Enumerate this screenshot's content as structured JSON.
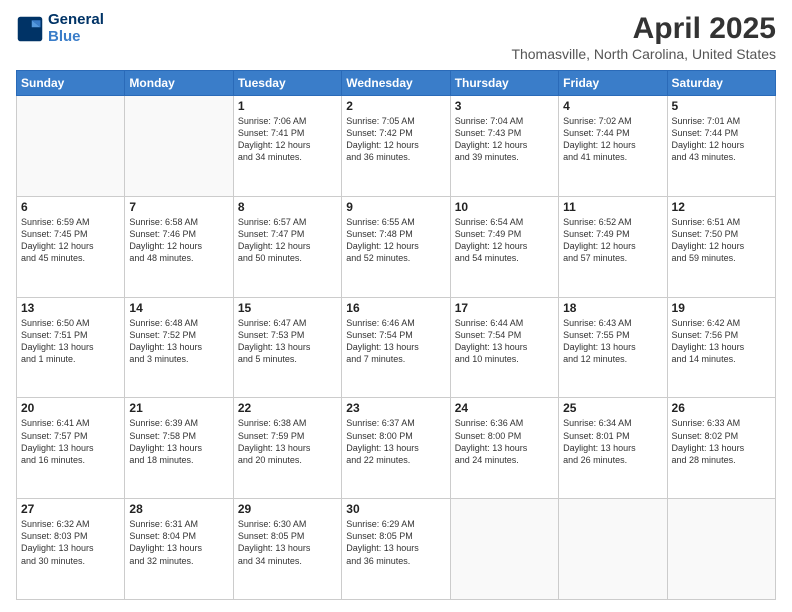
{
  "header": {
    "logo_line1": "General",
    "logo_line2": "Blue",
    "title": "April 2025",
    "subtitle": "Thomasville, North Carolina, United States"
  },
  "calendar": {
    "weekdays": [
      "Sunday",
      "Monday",
      "Tuesday",
      "Wednesday",
      "Thursday",
      "Friday",
      "Saturday"
    ],
    "weeks": [
      [
        {
          "day": "",
          "info": ""
        },
        {
          "day": "",
          "info": ""
        },
        {
          "day": "1",
          "info": "Sunrise: 7:06 AM\nSunset: 7:41 PM\nDaylight: 12 hours\nand 34 minutes."
        },
        {
          "day": "2",
          "info": "Sunrise: 7:05 AM\nSunset: 7:42 PM\nDaylight: 12 hours\nand 36 minutes."
        },
        {
          "day": "3",
          "info": "Sunrise: 7:04 AM\nSunset: 7:43 PM\nDaylight: 12 hours\nand 39 minutes."
        },
        {
          "day": "4",
          "info": "Sunrise: 7:02 AM\nSunset: 7:44 PM\nDaylight: 12 hours\nand 41 minutes."
        },
        {
          "day": "5",
          "info": "Sunrise: 7:01 AM\nSunset: 7:44 PM\nDaylight: 12 hours\nand 43 minutes."
        }
      ],
      [
        {
          "day": "6",
          "info": "Sunrise: 6:59 AM\nSunset: 7:45 PM\nDaylight: 12 hours\nand 45 minutes."
        },
        {
          "day": "7",
          "info": "Sunrise: 6:58 AM\nSunset: 7:46 PM\nDaylight: 12 hours\nand 48 minutes."
        },
        {
          "day": "8",
          "info": "Sunrise: 6:57 AM\nSunset: 7:47 PM\nDaylight: 12 hours\nand 50 minutes."
        },
        {
          "day": "9",
          "info": "Sunrise: 6:55 AM\nSunset: 7:48 PM\nDaylight: 12 hours\nand 52 minutes."
        },
        {
          "day": "10",
          "info": "Sunrise: 6:54 AM\nSunset: 7:49 PM\nDaylight: 12 hours\nand 54 minutes."
        },
        {
          "day": "11",
          "info": "Sunrise: 6:52 AM\nSunset: 7:49 PM\nDaylight: 12 hours\nand 57 minutes."
        },
        {
          "day": "12",
          "info": "Sunrise: 6:51 AM\nSunset: 7:50 PM\nDaylight: 12 hours\nand 59 minutes."
        }
      ],
      [
        {
          "day": "13",
          "info": "Sunrise: 6:50 AM\nSunset: 7:51 PM\nDaylight: 13 hours\nand 1 minute."
        },
        {
          "day": "14",
          "info": "Sunrise: 6:48 AM\nSunset: 7:52 PM\nDaylight: 13 hours\nand 3 minutes."
        },
        {
          "day": "15",
          "info": "Sunrise: 6:47 AM\nSunset: 7:53 PM\nDaylight: 13 hours\nand 5 minutes."
        },
        {
          "day": "16",
          "info": "Sunrise: 6:46 AM\nSunset: 7:54 PM\nDaylight: 13 hours\nand 7 minutes."
        },
        {
          "day": "17",
          "info": "Sunrise: 6:44 AM\nSunset: 7:54 PM\nDaylight: 13 hours\nand 10 minutes."
        },
        {
          "day": "18",
          "info": "Sunrise: 6:43 AM\nSunset: 7:55 PM\nDaylight: 13 hours\nand 12 minutes."
        },
        {
          "day": "19",
          "info": "Sunrise: 6:42 AM\nSunset: 7:56 PM\nDaylight: 13 hours\nand 14 minutes."
        }
      ],
      [
        {
          "day": "20",
          "info": "Sunrise: 6:41 AM\nSunset: 7:57 PM\nDaylight: 13 hours\nand 16 minutes."
        },
        {
          "day": "21",
          "info": "Sunrise: 6:39 AM\nSunset: 7:58 PM\nDaylight: 13 hours\nand 18 minutes."
        },
        {
          "day": "22",
          "info": "Sunrise: 6:38 AM\nSunset: 7:59 PM\nDaylight: 13 hours\nand 20 minutes."
        },
        {
          "day": "23",
          "info": "Sunrise: 6:37 AM\nSunset: 8:00 PM\nDaylight: 13 hours\nand 22 minutes."
        },
        {
          "day": "24",
          "info": "Sunrise: 6:36 AM\nSunset: 8:00 PM\nDaylight: 13 hours\nand 24 minutes."
        },
        {
          "day": "25",
          "info": "Sunrise: 6:34 AM\nSunset: 8:01 PM\nDaylight: 13 hours\nand 26 minutes."
        },
        {
          "day": "26",
          "info": "Sunrise: 6:33 AM\nSunset: 8:02 PM\nDaylight: 13 hours\nand 28 minutes."
        }
      ],
      [
        {
          "day": "27",
          "info": "Sunrise: 6:32 AM\nSunset: 8:03 PM\nDaylight: 13 hours\nand 30 minutes."
        },
        {
          "day": "28",
          "info": "Sunrise: 6:31 AM\nSunset: 8:04 PM\nDaylight: 13 hours\nand 32 minutes."
        },
        {
          "day": "29",
          "info": "Sunrise: 6:30 AM\nSunset: 8:05 PM\nDaylight: 13 hours\nand 34 minutes."
        },
        {
          "day": "30",
          "info": "Sunrise: 6:29 AM\nSunset: 8:05 PM\nDaylight: 13 hours\nand 36 minutes."
        },
        {
          "day": "",
          "info": ""
        },
        {
          "day": "",
          "info": ""
        },
        {
          "day": "",
          "info": ""
        }
      ]
    ]
  }
}
